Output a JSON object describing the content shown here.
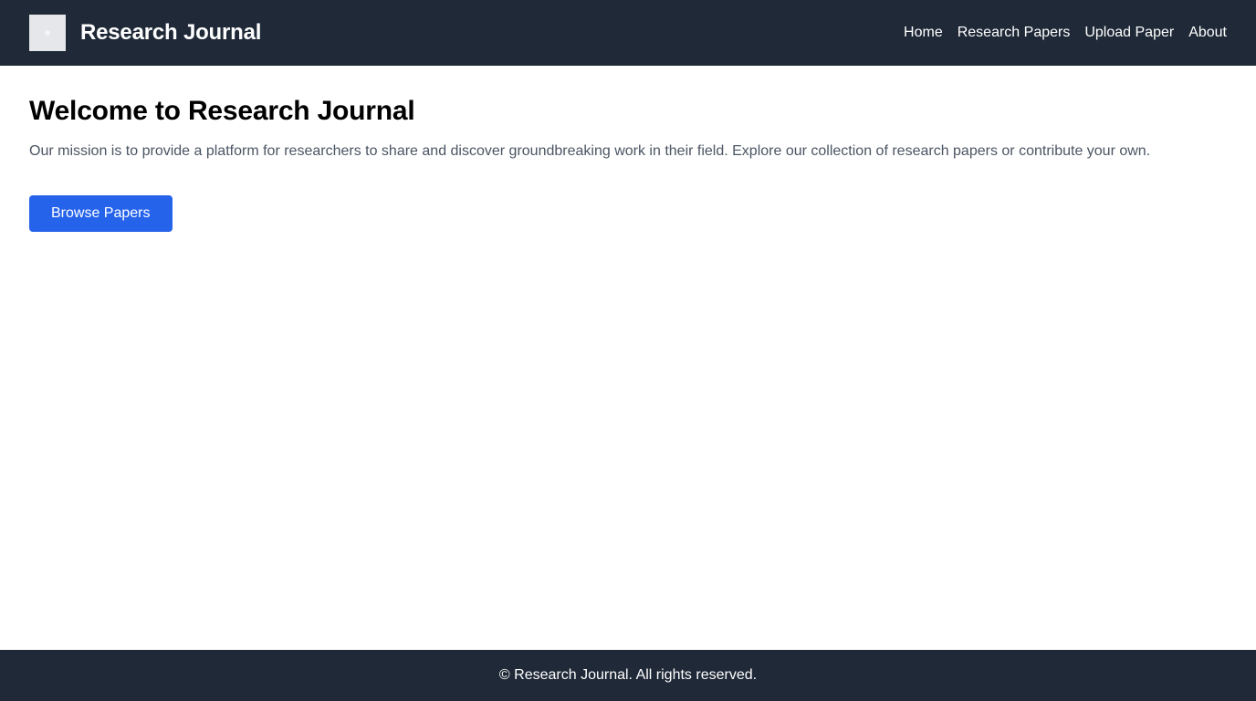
{
  "header": {
    "brand_title": "Research Journal",
    "logo_icon": "logo-placeholder-icon",
    "nav": [
      {
        "label": "Home"
      },
      {
        "label": "Research Papers"
      },
      {
        "label": "Upload Paper"
      },
      {
        "label": "About"
      }
    ]
  },
  "main": {
    "title": "Welcome to Research Journal",
    "mission": "Our mission is to provide a platform for researchers to share and discover groundbreaking work in their field. Explore our collection of research papers or contribute your own.",
    "browse_button": "Browse Papers"
  },
  "footer": {
    "text": "© Research Journal. All rights reserved."
  },
  "colors": {
    "header_bg": "#1f2937",
    "footer_bg": "#1f2937",
    "accent": "#2563eb",
    "body_text": "#4b5563"
  }
}
